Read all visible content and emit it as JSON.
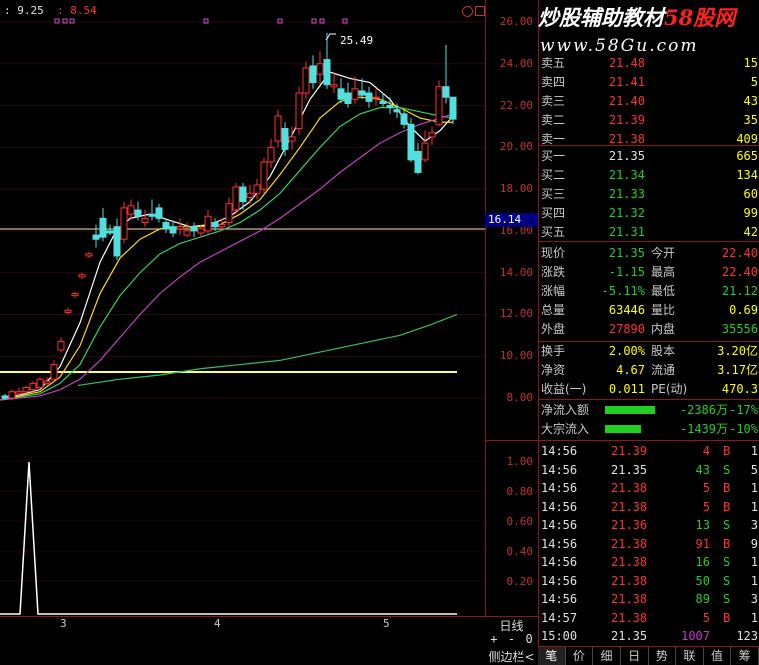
{
  "header": {
    "left_value": "9.25",
    "right_value": "8.54"
  },
  "peak_label": "25.49",
  "price_axis": {
    "ticks": [
      "26.00",
      "24.00",
      "22.00",
      "20.00",
      "18.00",
      "16.00",
      "14.00",
      "12.00",
      "10.00",
      "8.00"
    ]
  },
  "current_price_label": "16.14",
  "indicator_axis": {
    "ticks": [
      "1.00",
      "0.80",
      "0.60",
      "0.40",
      "0.20"
    ]
  },
  "x_axis": {
    "labels": [
      "3",
      "4",
      "5"
    ]
  },
  "period": "日线",
  "zoom": {
    "plus": "+",
    "minus": "-",
    "zero": "0"
  },
  "sidebar_toggle": "侧边栏<",
  "watermark": {
    "text_a": "炒股辅助教材",
    "text_b": "58股网",
    "url": "www.58Gu.com"
  },
  "asks": [
    {
      "label": "卖五",
      "price": "21.48",
      "vol": "15"
    },
    {
      "label": "卖四",
      "price": "21.41",
      "vol": "5"
    },
    {
      "label": "卖三",
      "price": "21.40",
      "vol": "43"
    },
    {
      "label": "卖二",
      "price": "21.39",
      "vol": "35"
    },
    {
      "label": "卖一",
      "price": "21.38",
      "vol": "409"
    }
  ],
  "bids": [
    {
      "label": "买一",
      "price": "21.35",
      "vol": "665"
    },
    {
      "label": "买二",
      "price": "21.34",
      "vol": "134"
    },
    {
      "label": "买三",
      "price": "21.33",
      "vol": "60"
    },
    {
      "label": "买四",
      "price": "21.32",
      "vol": "99"
    },
    {
      "label": "买五",
      "price": "21.31",
      "vol": "42"
    }
  ],
  "quote": [
    {
      "l1": "现价",
      "v1": "21.35",
      "l2": "今开",
      "v2": "22.40"
    },
    {
      "l1": "涨跌",
      "v1": "-1.15",
      "l2": "最高",
      "v2": "22.40"
    },
    {
      "l1": "涨幅",
      "v1": "-5.11%",
      "l2": "最低",
      "v2": "21.12"
    },
    {
      "l1": "总量",
      "v1": "63446",
      "l2": "量比",
      "v2": "0.69"
    },
    {
      "l1": "外盘",
      "v1": "27890",
      "l2": "内盘",
      "v2": "35556"
    }
  ],
  "fundamentals": [
    {
      "l1": "换手",
      "v1": "2.00%",
      "l2": "股本",
      "v2": "3.20亿"
    },
    {
      "l1": "净资",
      "v1": "4.67",
      "l2": "流通",
      "v2": "3.17亿"
    },
    {
      "l1": "收益(一)",
      "v1": "0.011",
      "l2": "PE(动)",
      "v2": "470.3"
    }
  ],
  "flows": [
    {
      "label": "净流入额",
      "amount": "-2386万",
      "pct": "-17%",
      "bar": 0.62
    },
    {
      "label": "大宗流入",
      "amount": "-1439万",
      "pct": "-10%",
      "bar": 0.45
    }
  ],
  "ticks": [
    {
      "time": "14:56",
      "price": "21.39",
      "vol": "4",
      "side": "B",
      "n": "1"
    },
    {
      "time": "14:56",
      "price": "21.35",
      "vol": "43",
      "side": "S",
      "n": "5"
    },
    {
      "time": "14:56",
      "price": "21.38",
      "vol": "5",
      "side": "B",
      "n": "1"
    },
    {
      "time": "14:56",
      "price": "21.38",
      "vol": "5",
      "side": "B",
      "n": "1"
    },
    {
      "time": "14:56",
      "price": "21.36",
      "vol": "13",
      "side": "S",
      "n": "3"
    },
    {
      "time": "14:56",
      "price": "21.38",
      "vol": "91",
      "side": "B",
      "n": "9"
    },
    {
      "time": "14:56",
      "price": "21.38",
      "vol": "16",
      "side": "S",
      "n": "1"
    },
    {
      "time": "14:56",
      "price": "21.38",
      "vol": "50",
      "side": "S",
      "n": "1"
    },
    {
      "time": "14:56",
      "price": "21.38",
      "vol": "89",
      "side": "S",
      "n": "3"
    },
    {
      "time": "14:57",
      "price": "21.38",
      "vol": "5",
      "side": "B",
      "n": "1"
    },
    {
      "time": "15:00",
      "price": "21.35",
      "vol": "1007",
      "side": "",
      "n": "123"
    }
  ],
  "tabs": [
    "笔",
    "价",
    "细",
    "日",
    "势",
    "联",
    "值",
    "筹"
  ]
}
